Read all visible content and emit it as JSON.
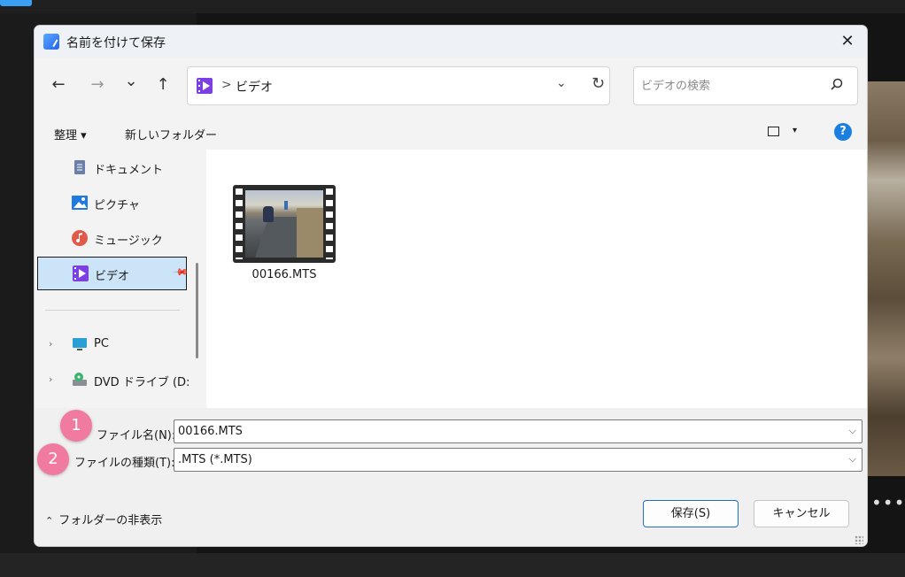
{
  "dialog": {
    "title": "名前を付けて保存",
    "close_glyph": "✕"
  },
  "nav": {
    "back": "←",
    "forward": "→",
    "recent": "⌄",
    "up": "↑"
  },
  "address": {
    "separator": ">",
    "path": "ビデオ",
    "dropdown": "⌄",
    "refresh": "↻"
  },
  "search": {
    "placeholder": "ビデオの検索",
    "icon": "search-icon"
  },
  "toolbar": {
    "organize": "整理 ▾",
    "new_folder": "新しいフォルダー",
    "view_caret": "▾",
    "help": "?"
  },
  "sidebar": {
    "items": [
      {
        "label": "ドキュメント",
        "icon": "document-icon",
        "pinned": true
      },
      {
        "label": "ピクチャ",
        "icon": "picture-icon",
        "pinned": true
      },
      {
        "label": "ミュージック",
        "icon": "music-icon",
        "pinned": true
      },
      {
        "label": "ビデオ",
        "icon": "video-icon",
        "pinned": true,
        "selected": true
      },
      {
        "label": "PC",
        "icon": "pc-icon",
        "expandable": true
      },
      {
        "label": "DVD ドライブ (D:)",
        "icon": "dvd-drive-icon",
        "expandable": true
      }
    ],
    "pin_glyph": "📌",
    "expand_glyph": "›"
  },
  "files": [
    {
      "name": "00166.MTS",
      "type": "video"
    }
  ],
  "form": {
    "filename_label": "ファイル名(N):",
    "filename_value": "00166.MTS",
    "filetype_label": "ファイルの種類(T):",
    "filetype_value": ".MTS (*.MTS)",
    "badge1": "1",
    "badge2": "2"
  },
  "footer": {
    "hide_folders": "フォルダーの非表示",
    "save": "保存(S)",
    "cancel": "キャンセル"
  },
  "background": {
    "more": "•••"
  },
  "colors": {
    "accent": "#1b7fe0",
    "selected_bg": "#cce4f7",
    "badge": "#f07aa0",
    "video_icon": "#7b3fe4"
  }
}
